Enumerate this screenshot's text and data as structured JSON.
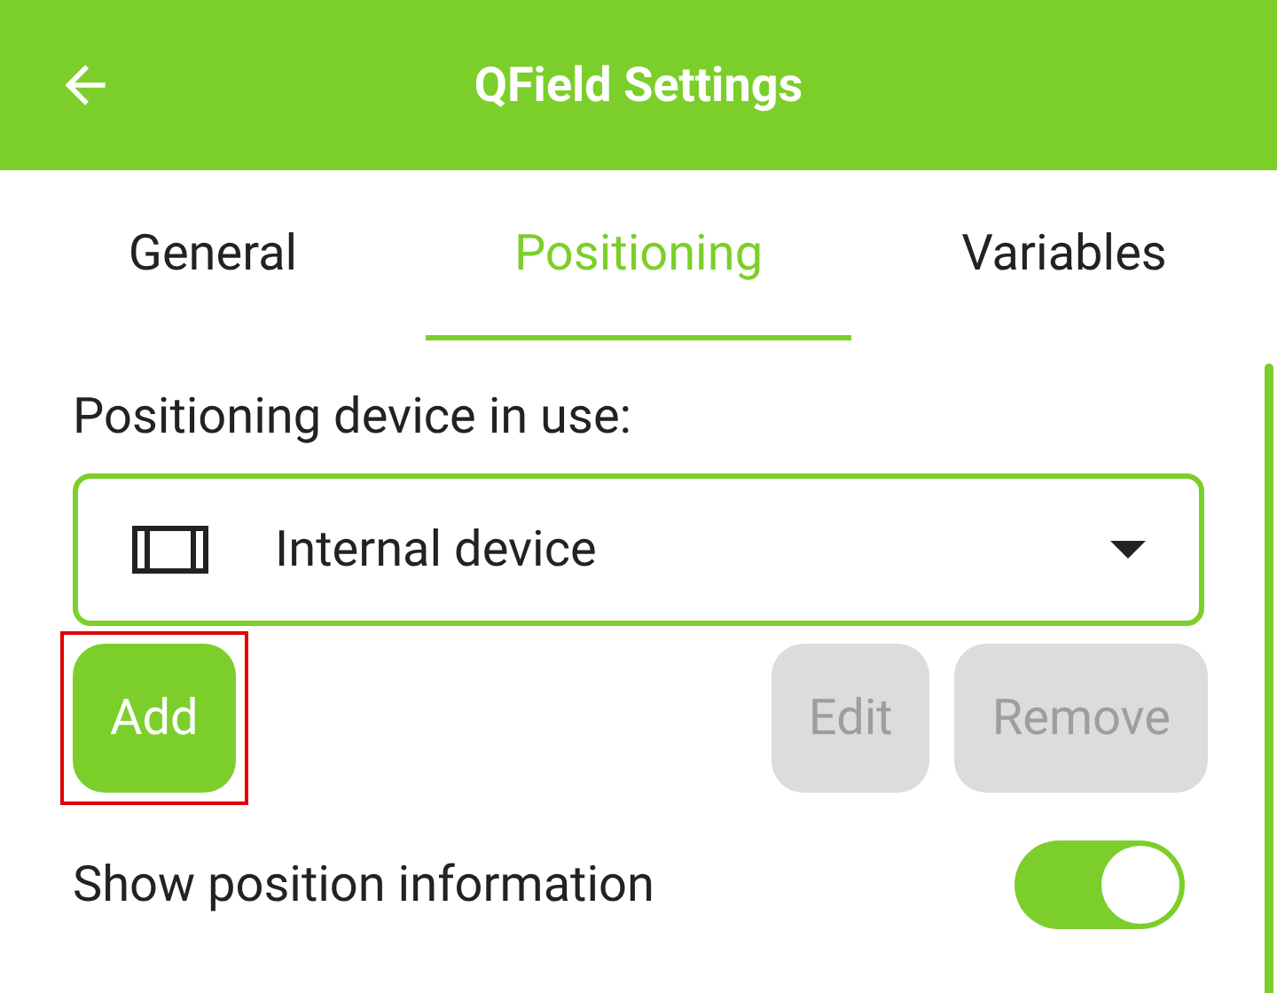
{
  "header": {
    "title": "QField Settings"
  },
  "tabs": [
    {
      "label": "General",
      "selected": false
    },
    {
      "label": "Positioning",
      "selected": true
    },
    {
      "label": "Variables",
      "selected": false
    }
  ],
  "device_label": "Positioning device in use:",
  "device_select": {
    "value": "Internal device"
  },
  "buttons": [
    {
      "label": "Add",
      "disabled": false,
      "highlighted": true
    },
    {
      "label": "Edit",
      "disabled": true,
      "highlighted": false
    },
    {
      "label": "Remove",
      "disabled": true,
      "highlighted": false
    }
  ],
  "toggles": [
    {
      "label": "Show position information",
      "on": true
    }
  ]
}
